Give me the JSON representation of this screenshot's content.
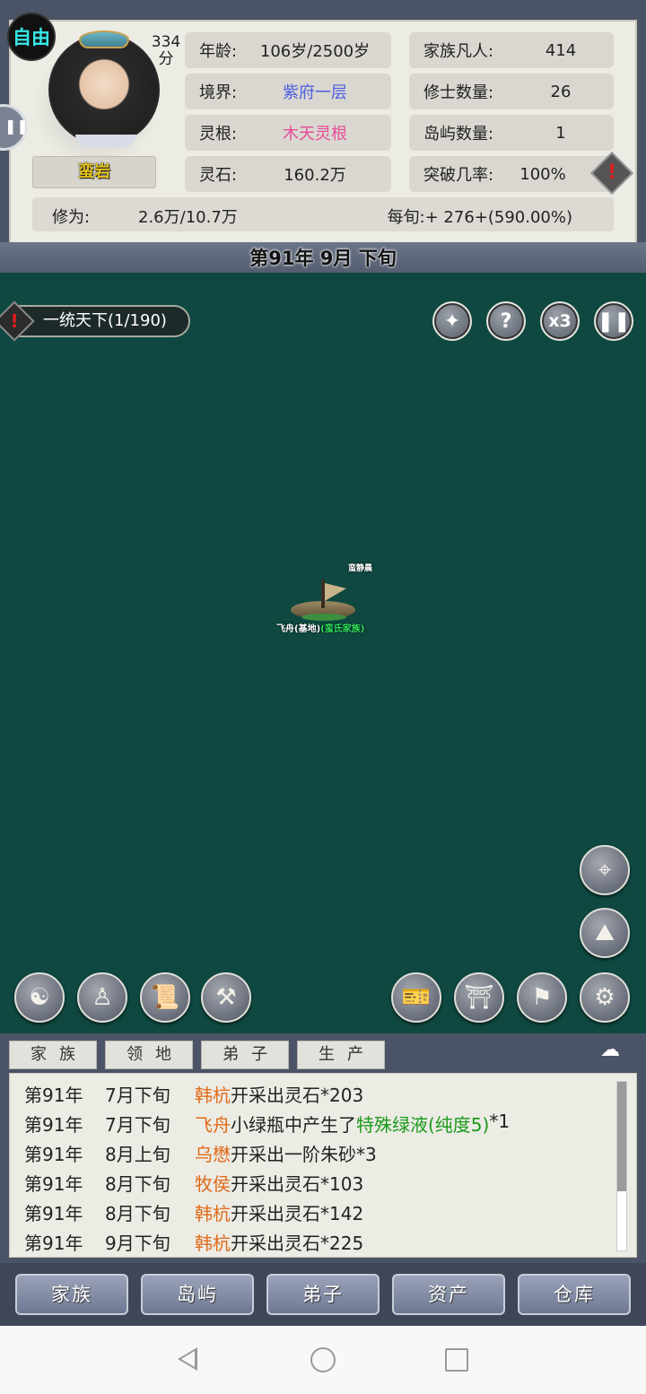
{
  "header": {
    "free_badge": "自由",
    "score_value": "334",
    "score_unit": "分",
    "character_name": "蛮岩",
    "stats": {
      "age_label": "年龄:",
      "age_value": "106岁/2500岁",
      "realm_label": "境界:",
      "realm_value": "紫府一层",
      "root_label": "灵根:",
      "root_value": "木天灵根",
      "stone_label": "灵石:",
      "stone_value": "160.2万",
      "mortals_label": "家族凡人:",
      "mortals_value": "414",
      "cultivators_label": "修士数量:",
      "cultivators_value": "26",
      "islands_label": "岛屿数量:",
      "islands_value": "1",
      "breakthrough_label": "突破几率:",
      "breakthrough_value": "100%"
    },
    "cultivation_label": "修为:",
    "cultivation_value": "2.6万/10.7万",
    "rate_text": "每旬:+ 276+(590.00%)",
    "colors": {
      "realm": "#4c5ee0",
      "root": "#e84b9b",
      "name": "#e6c21a",
      "free": "#37e6e6"
    }
  },
  "date": "第91年 9月 下旬",
  "map": {
    "quest_text": "一统天下(1/190)",
    "speed_label": "x3",
    "help_label": "?",
    "pause_icon": "pause-icon",
    "emblem_icon": "emblem-icon",
    "ship_top_label": "蛮静晨",
    "ship_label_main": "飞舟(基地)",
    "ship_label_family": "(蛮氏家族)",
    "map_color": "#0e4840"
  },
  "log": {
    "tabs": [
      "家族",
      "领地",
      "弟子",
      "生产"
    ],
    "entries": [
      {
        "year": "第91年",
        "month": "7月下旬",
        "who": "韩杭",
        "action": "开采出灵石*203",
        "item": "",
        "tail": ""
      },
      {
        "year": "第91年",
        "month": "7月下旬",
        "who": "飞舟",
        "action": "小绿瓶中产生了",
        "item": "特殊绿液(纯度5)",
        "tail": "*1"
      },
      {
        "year": "第91年",
        "month": "8月上旬",
        "who": "乌懋",
        "action": "开采出一阶朱砂*3",
        "item": "",
        "tail": ""
      },
      {
        "year": "第91年",
        "month": "8月下旬",
        "who": "牧侯",
        "action": "开采出灵石*103",
        "item": "",
        "tail": ""
      },
      {
        "year": "第91年",
        "month": "8月下旬",
        "who": "韩杭",
        "action": "开采出灵石*142",
        "item": "",
        "tail": ""
      },
      {
        "year": "第91年",
        "month": "9月下旬",
        "who": "韩杭",
        "action": "开采出灵石*225",
        "item": "",
        "tail": ""
      }
    ]
  },
  "bottom_nav": [
    "家族",
    "岛屿",
    "弟子",
    "资产",
    "仓库"
  ]
}
